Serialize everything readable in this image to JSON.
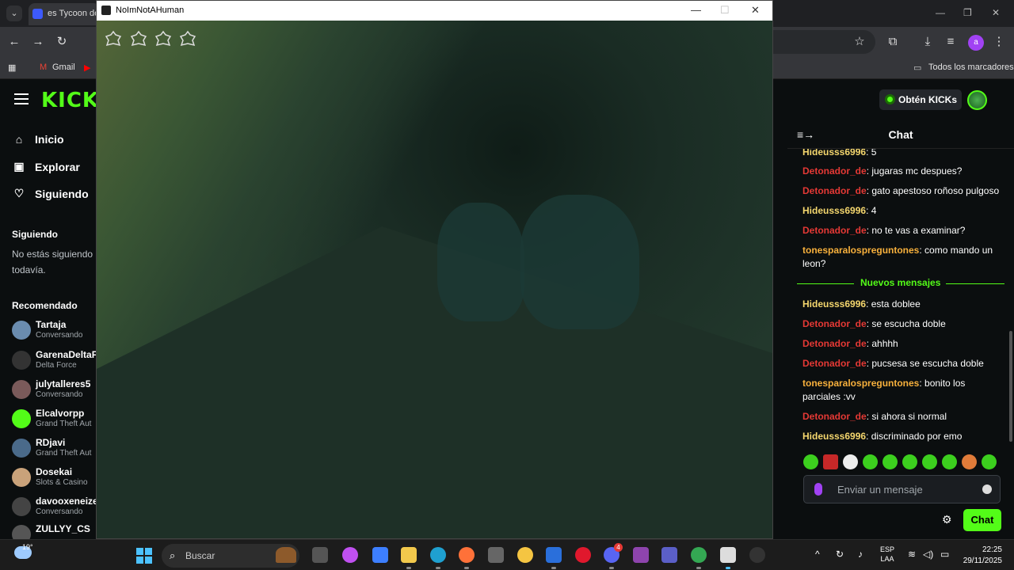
{
  "browser": {
    "tab_title": "es Tycoon de",
    "bookmarks": {
      "gmail": "Gmail",
      "all_bookmarks": "Todos los marcadores"
    },
    "profile_initial": "a"
  },
  "game_window": {
    "title": "NoImNotAHuman"
  },
  "kick": {
    "logo": "KICK",
    "kicks_button": "Obtén KICKs",
    "nav": [
      {
        "label": "Inicio",
        "icon": "home-icon"
      },
      {
        "label": "Explorar",
        "icon": "compass-icon"
      },
      {
        "label": "Siguiendo",
        "icon": "heart-icon"
      }
    ],
    "following_heading": "Siguiendo",
    "following_empty_1": "No estás siguiendo",
    "following_empty_2": "todavía.",
    "recommended_heading": "Recomendado",
    "recommended": [
      {
        "name": "Tartaja",
        "sub": "Conversando",
        "color": "#6a8caf"
      },
      {
        "name": "GarenaDeltaF",
        "sub": "Delta Force",
        "color": "#333"
      },
      {
        "name": "julytalleres5",
        "sub": "Conversando",
        "color": "#7a5a5a"
      },
      {
        "name": "Elcalvorpp",
        "sub": "Grand Theft Aut",
        "color": "#53fc18"
      },
      {
        "name": "RDjavi",
        "sub": "Grand Theft Aut",
        "color": "#4a6a8a"
      },
      {
        "name": "Dosekai",
        "sub": "Slots & Casino",
        "color": "#c9a27a"
      },
      {
        "name": "davooxeneize",
        "sub": "Conversando",
        "color": "#444"
      },
      {
        "name": "ZULLYY_CS",
        "sub": "",
        "color": "#555"
      }
    ]
  },
  "chat": {
    "title": "Chat",
    "new_messages": "Nuevos mensajes",
    "messages_before": [
      {
        "user": "Hideusss6996",
        "text": ": 5",
        "kind": "yellow"
      },
      {
        "user": "Detonador_de",
        "text": ": jugaras mc despues?",
        "kind": "red"
      },
      {
        "user": "Detonador_de",
        "text": ": gato apestoso roñoso pulgoso",
        "kind": "red"
      },
      {
        "user": "Hideusss6996",
        "text": ": 4",
        "kind": "yellow"
      },
      {
        "user": "Detonador_de",
        "text": ": no te vas a examinar?",
        "kind": "red"
      },
      {
        "user": "tonesparalospreguntones",
        "text": ": como mando un leon?",
        "kind": "orange"
      }
    ],
    "messages_after": [
      {
        "user": "Hideusss6996",
        "text": ": esta doblee",
        "kind": "yellow"
      },
      {
        "user": "Detonador_de",
        "text": ": se escucha doble",
        "kind": "red"
      },
      {
        "user": "Detonador_de",
        "text": ": ahhhh",
        "kind": "red"
      },
      {
        "user": "Detonador_de",
        "text": ": pucsesa se escucha doble",
        "kind": "red"
      },
      {
        "user": "tonesparalospreguntones",
        "text": ": bonito los parciales :vv",
        "kind": "orange"
      },
      {
        "user": "Detonador_de",
        "text": ": si ahora si normal",
        "kind": "red"
      },
      {
        "user": "Hideusss6996",
        "text": ": discriminado por emo",
        "kind": "yellow"
      }
    ],
    "input_placeholder": "Enviar un mensaje",
    "send_label": "Chat"
  },
  "taskbar": {
    "temperature": "19°",
    "search_placeholder": "Buscar",
    "lang_1": "ESP",
    "lang_2": "LAA",
    "time": "22:25",
    "date": "29/11/2025",
    "discord_badge": "4"
  }
}
